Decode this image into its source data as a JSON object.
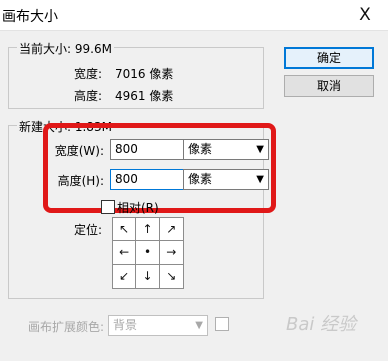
{
  "window": {
    "title": "画布大小",
    "close_glyph": "X"
  },
  "current_size": {
    "legend": "当前大小: 99.6M",
    "width_label": "宽度:",
    "width_value": "7016 像素",
    "height_label": "高度:",
    "height_value": "4961 像素"
  },
  "new_size": {
    "legend": "新建大小: 1.83M",
    "width_label": "宽度(W):",
    "width_value": "800",
    "width_unit": "像素",
    "height_label": "高度(H):",
    "height_value": "800",
    "height_unit": "像素",
    "relative_label": "相对(R)",
    "anchor_label": "定位:",
    "anchor_arrows": [
      "↖",
      "↑",
      "↗",
      "←",
      "•",
      "→",
      "↙",
      "↓",
      "↘"
    ]
  },
  "buttons": {
    "ok": "确定",
    "cancel": "取消"
  },
  "extension": {
    "label": "画布扩展颜色:",
    "value": "背景"
  },
  "watermark": "Bai 经验",
  "colors": {
    "highlight": "#e01818",
    "accent": "#0078d7"
  }
}
